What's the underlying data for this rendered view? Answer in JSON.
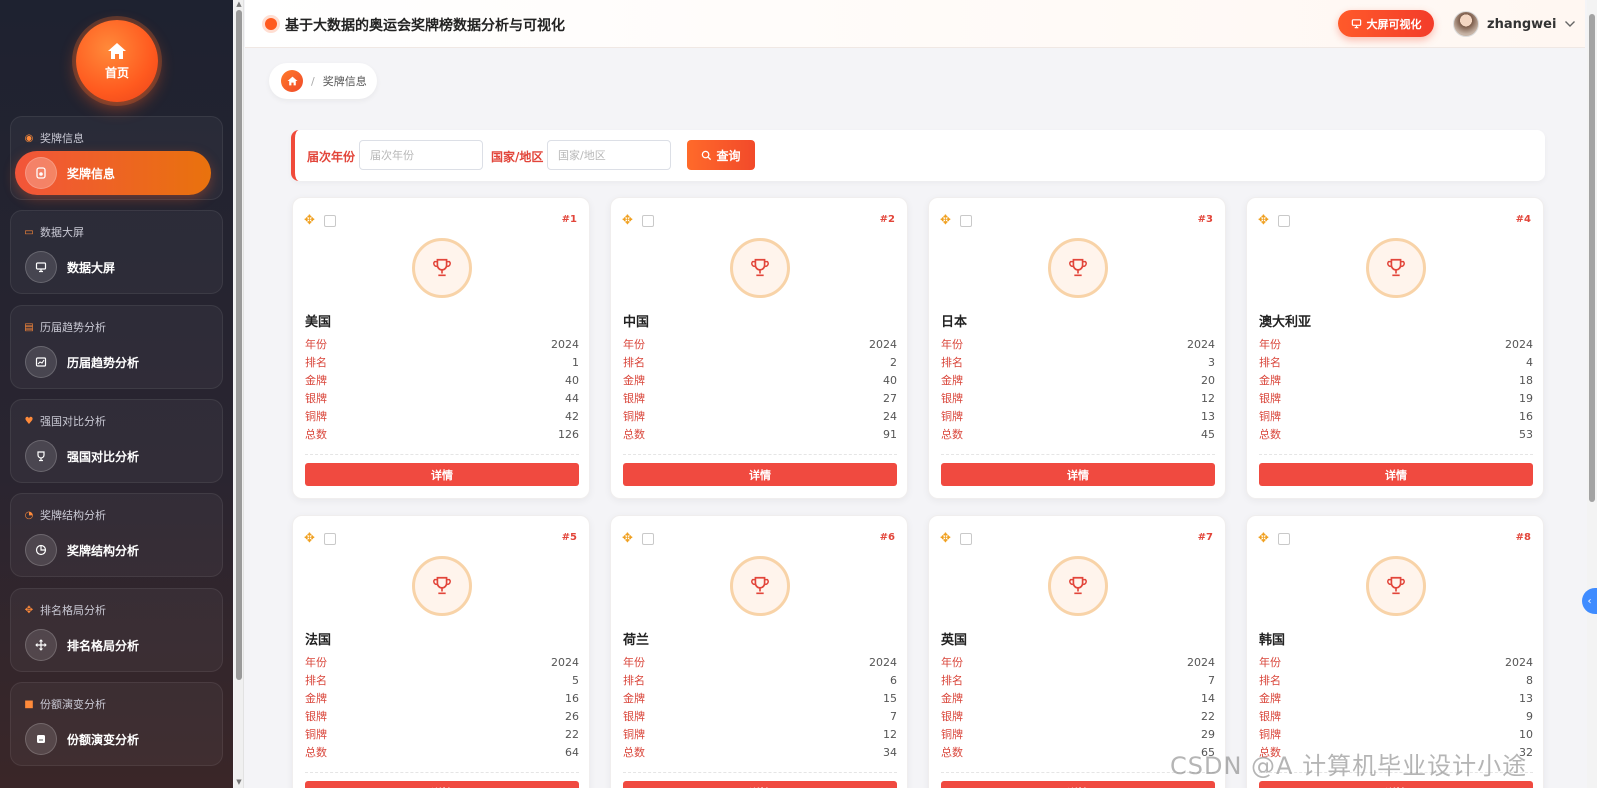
{
  "sidebar": {
    "home_label": "首页",
    "groups": [
      {
        "title": "奖牌信息",
        "item": "奖牌信息",
        "icon": "medal-icon",
        "active": true
      },
      {
        "title": "数据大屏",
        "item": "数据大屏",
        "icon": "monitor-icon",
        "active": false
      },
      {
        "title": "历届趋势分析",
        "item": "历届趋势分析",
        "icon": "trend-icon",
        "active": false
      },
      {
        "title": "强国对比分析",
        "item": "强国对比分析",
        "icon": "trophy-icon",
        "active": false
      },
      {
        "title": "奖牌结构分析",
        "item": "奖牌结构分析",
        "icon": "pie-icon",
        "active": false
      },
      {
        "title": "排名格局分析",
        "item": "排名格局分析",
        "icon": "move-icon",
        "active": false
      },
      {
        "title": "份额演变分析",
        "item": "份额演变分析",
        "icon": "box-icon",
        "active": false
      }
    ]
  },
  "header": {
    "title": "基于大数据的奥运会奖牌榜数据分析与可视化",
    "bigscreen_label": "大屏可视化",
    "username": "zhangwei"
  },
  "breadcrumb": {
    "current": "奖牌信息"
  },
  "search": {
    "year_label": "届次年份",
    "year_placeholder": "届次年份",
    "country_label": "国家/地区",
    "country_placeholder": "国家/地区",
    "query_label": "查询"
  },
  "card_labels": {
    "year": "年份",
    "rank": "排名",
    "gold": "金牌",
    "silver": "银牌",
    "bronze": "铜牌",
    "total": "总数",
    "detail": "详情"
  },
  "cards": [
    {
      "tag": "#1",
      "country": "美国",
      "year": "2024",
      "rank": "1",
      "gold": "40",
      "silver": "44",
      "bronze": "42",
      "total": "126"
    },
    {
      "tag": "#2",
      "country": "中国",
      "year": "2024",
      "rank": "2",
      "gold": "40",
      "silver": "27",
      "bronze": "24",
      "total": "91"
    },
    {
      "tag": "#3",
      "country": "日本",
      "year": "2024",
      "rank": "3",
      "gold": "20",
      "silver": "12",
      "bronze": "13",
      "total": "45"
    },
    {
      "tag": "#4",
      "country": "澳大利亚",
      "year": "2024",
      "rank": "4",
      "gold": "18",
      "silver": "19",
      "bronze": "16",
      "total": "53"
    },
    {
      "tag": "#5",
      "country": "法国",
      "year": "2024",
      "rank": "5",
      "gold": "16",
      "silver": "26",
      "bronze": "22",
      "total": "64"
    },
    {
      "tag": "#6",
      "country": "荷兰",
      "year": "2024",
      "rank": "6",
      "gold": "15",
      "silver": "7",
      "bronze": "12",
      "total": "34"
    },
    {
      "tag": "#7",
      "country": "英国",
      "year": "2024",
      "rank": "7",
      "gold": "14",
      "silver": "22",
      "bronze": "29",
      "total": "65"
    },
    {
      "tag": "#8",
      "country": "韩国",
      "year": "2024",
      "rank": "8",
      "gold": "13",
      "silver": "9",
      "bronze": "10",
      "total": "32"
    }
  ],
  "watermark": "CSDN @A 计算机毕业设计小途",
  "colors": {
    "accent": "#ff5a1f",
    "label_red": "#d9453a",
    "button_red": "#f04a40"
  }
}
